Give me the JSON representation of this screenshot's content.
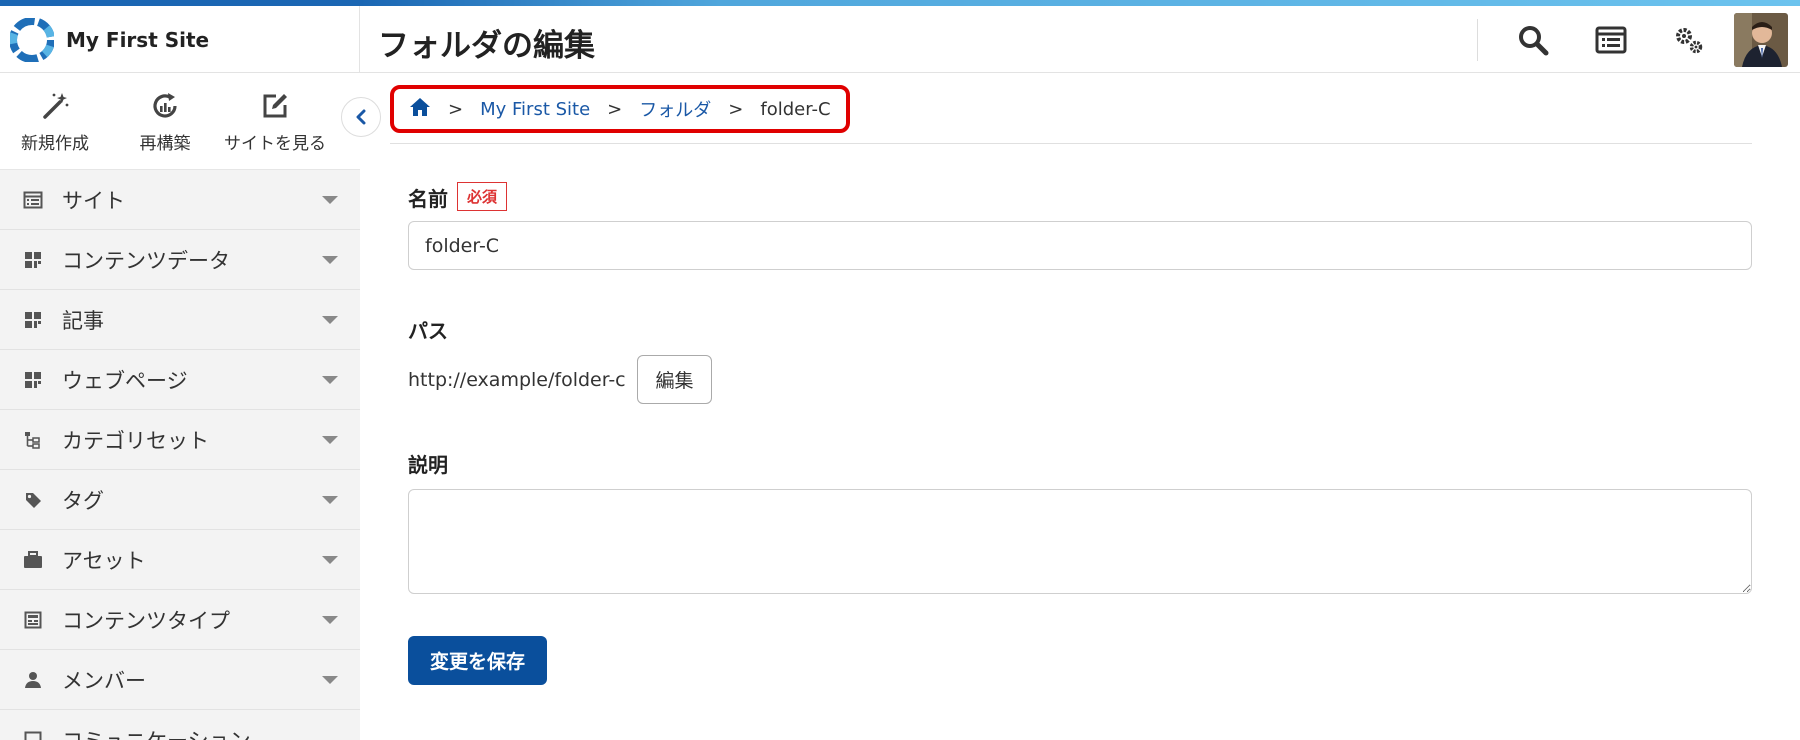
{
  "app": {
    "site_name": "My First Site",
    "page_title": "フォルダの編集"
  },
  "header": {
    "tools": [
      {
        "name": "search-icon"
      },
      {
        "name": "list-window-icon"
      },
      {
        "name": "gears-icon"
      }
    ]
  },
  "sidebar": {
    "quick_actions": [
      {
        "label": "新規作成",
        "icon": "magic-wand-icon"
      },
      {
        "label": "再構築",
        "icon": "rebuild-icon"
      },
      {
        "label": "サイトを見る",
        "icon": "external-edit-icon"
      }
    ],
    "items": [
      {
        "label": "サイト",
        "icon": "site-icon"
      },
      {
        "label": "コンテンツデータ",
        "icon": "content-data-icon"
      },
      {
        "label": "記事",
        "icon": "entry-icon"
      },
      {
        "label": "ウェブページ",
        "icon": "webpage-icon"
      },
      {
        "label": "カテゴリセット",
        "icon": "category-set-icon"
      },
      {
        "label": "タグ",
        "icon": "tag-icon"
      },
      {
        "label": "アセット",
        "icon": "asset-icon"
      },
      {
        "label": "コンテンツタイプ",
        "icon": "content-type-icon"
      },
      {
        "label": "メンバー",
        "icon": "member-icon"
      },
      {
        "label": "コミュニケーション",
        "icon": "communication-icon"
      }
    ]
  },
  "breadcrumb": {
    "home_icon": "home-icon",
    "separator": ">",
    "links": [
      "My First Site",
      "フォルダ"
    ],
    "current": "folder-C"
  },
  "form": {
    "name_label": "名前",
    "required_badge": "必須",
    "name_value": "folder-C",
    "path_label": "パス",
    "path_value": "http://example/folder-c",
    "path_edit_button": "編集",
    "description_label": "説明",
    "description_value": "",
    "save_button": "変更を保存"
  },
  "colors": {
    "accent": "#0a4f9c",
    "link": "#1a58a6",
    "required": "#d33333",
    "highlight_border": "#e00000"
  }
}
